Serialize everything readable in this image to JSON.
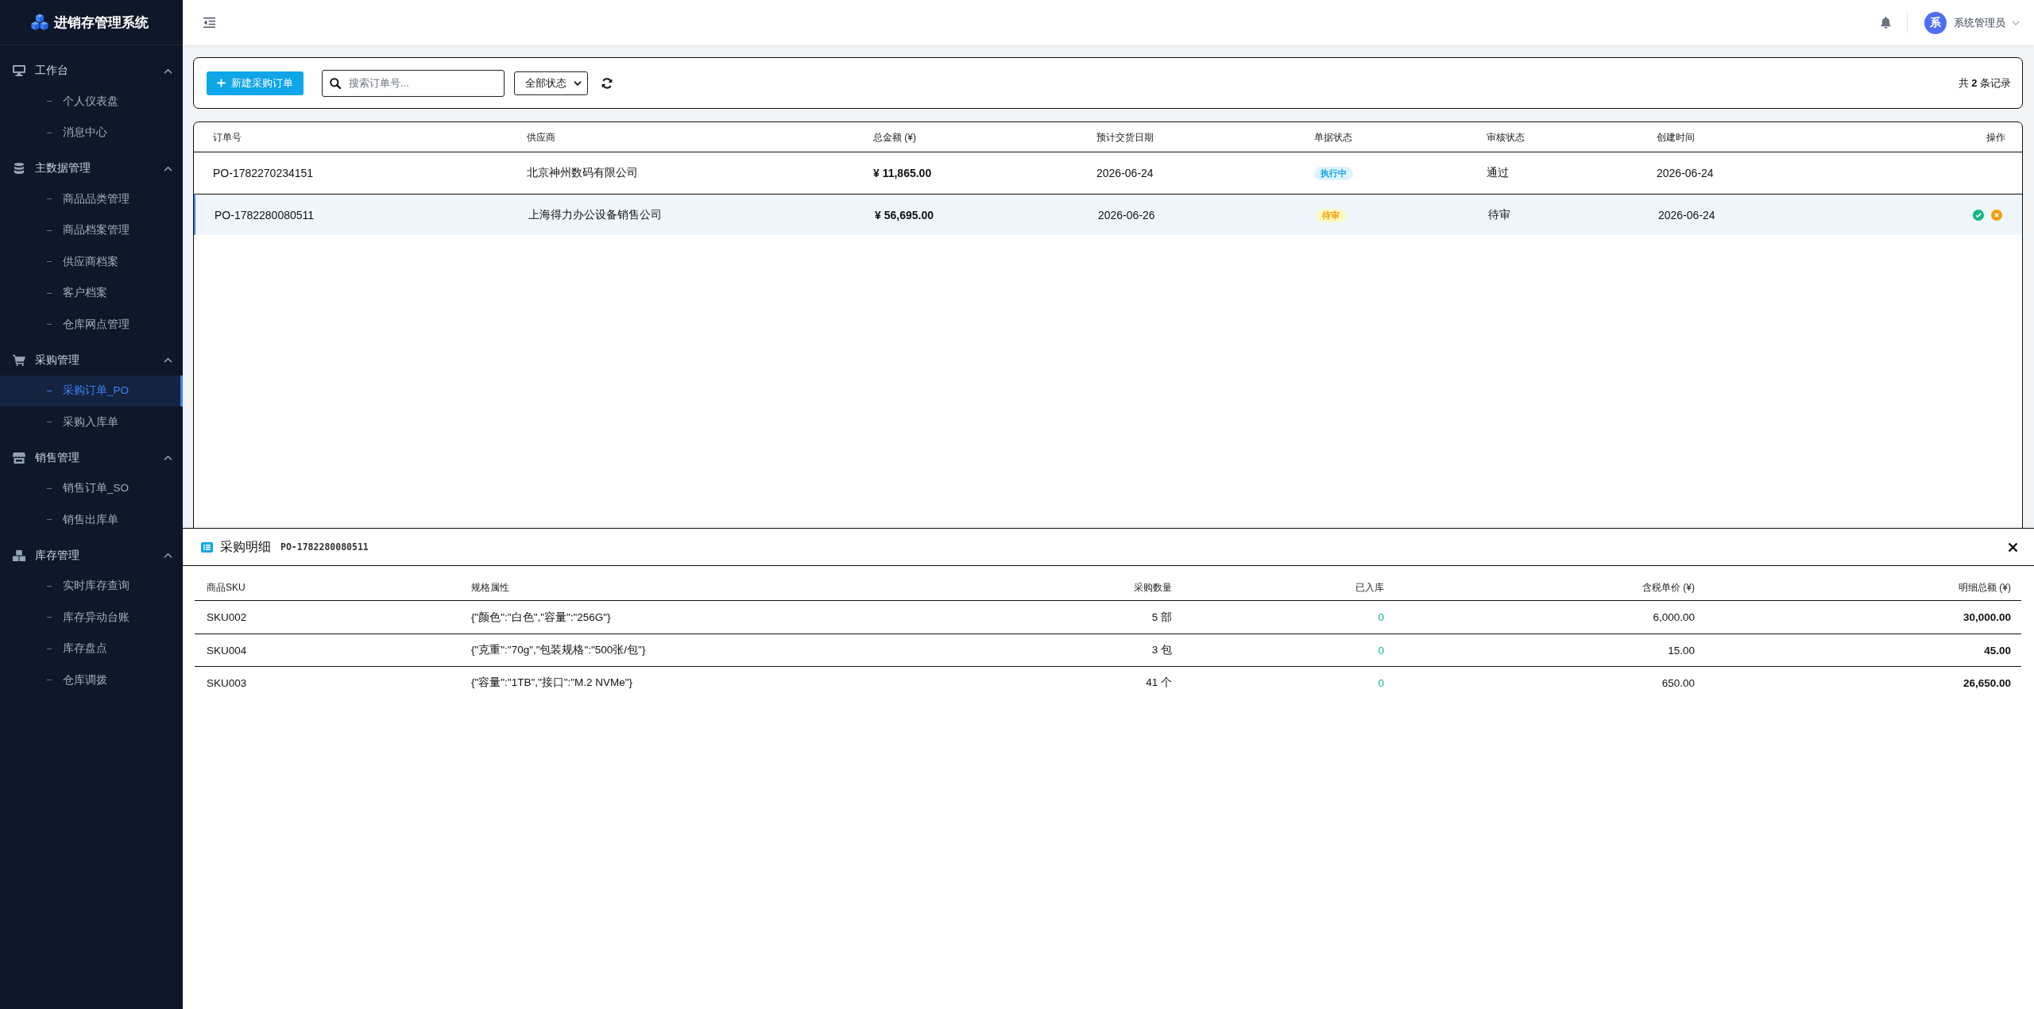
{
  "sidebar": {
    "logo": "进销存管理系统",
    "groups": [
      {
        "label": "工作台",
        "expanded": true,
        "children": [
          {
            "label": "个人仪表盘",
            "selected": false
          },
          {
            "label": "消息中心",
            "selected": false
          }
        ]
      },
      {
        "label": "主数据管理",
        "expanded": true,
        "children": [
          {
            "label": "商品品类管理",
            "selected": false
          },
          {
            "label": "商品档案管理",
            "selected": false
          },
          {
            "label": "供应商档案",
            "selected": false
          },
          {
            "label": "客户档案",
            "selected": false
          },
          {
            "label": "仓库网点管理",
            "selected": false
          }
        ]
      },
      {
        "label": "采购管理",
        "expanded": true,
        "children": [
          {
            "label": "采购订单_PO",
            "selected": true
          },
          {
            "label": "采购入库单",
            "selected": false
          }
        ]
      },
      {
        "label": "销售管理",
        "expanded": true,
        "children": [
          {
            "label": "销售订单_SO",
            "selected": false
          },
          {
            "label": "销售出库单",
            "selected": false
          }
        ]
      },
      {
        "label": "库存管理",
        "expanded": true,
        "children": [
          {
            "label": "实时库存查询",
            "selected": false
          },
          {
            "label": "库存异动台账",
            "selected": false
          },
          {
            "label": "库存盘点",
            "selected": false
          },
          {
            "label": "仓库调拨",
            "selected": false
          }
        ]
      }
    ]
  },
  "header": {
    "avatar_initial": "系",
    "user_name": "系统管理员"
  },
  "toolbar": {
    "new_button": "新建采购订单",
    "search": {
      "placeholder": "搜索订单号..."
    },
    "status_filter": "全部状态",
    "record_count": "共 **2** 条记录"
  },
  "orders_table": {
    "columns": [
      "订单号",
      "供应商",
      "总金额 (¥)",
      "预计交货日期",
      "单据状态",
      "审核状态",
      "创建时间",
      "操作"
    ],
    "rows": [
      {
        "order_no": "PO-1782270234151",
        "supplier": "北京神州数码有限公司",
        "total": "¥ 11,865.00",
        "delivery_date": "2026-06-24",
        "doc_status": {
          "text": "执行中",
          "kind": "executing"
        },
        "audit_status": "通过",
        "created": "2026-06-24",
        "selected": false
      },
      {
        "order_no": "PO-1782280080511",
        "supplier": "上海得力办公设备销售公司",
        "total": "¥ 56,695.00",
        "delivery_date": "2026-06-26",
        "doc_status": {
          "text": "待审",
          "kind": "pending"
        },
        "audit_status": "待审",
        "created": "2026-06-24",
        "selected": true,
        "actions": [
          {
            "kind": "approve"
          },
          {
            "kind": "reject"
          }
        ]
      }
    ]
  },
  "detail_panel": {
    "title": "采购明细",
    "order_no": "PO-1782280080511",
    "columns": [
      "商品SKU",
      "规格属性",
      "采购数量",
      "已入库",
      "含税单价 (¥)",
      "明细总额 (¥)"
    ],
    "rows": [
      {
        "sku": "SKU002",
        "spec": "{\"颜色\":\"白色\",\"容量\":\"256G\"}",
        "quantity": "5 部",
        "received": "0",
        "unit_price": "6,000.00",
        "line_total": "30,000.00"
      },
      {
        "sku": "SKU004",
        "spec": "{\"克重\":\"70g\",\"包装规格\":\"500张/包\"}",
        "quantity": "3 包",
        "received": "0",
        "unit_price": "15.00",
        "line_total": "45.00"
      },
      {
        "sku": "SKU003",
        "spec": "{\"容量\":\"1TB\",\"接口\":\"M.2 NVMe\"}",
        "quantity": "41 个",
        "received": "0",
        "unit_price": "650.00",
        "line_total": "26,650.00"
      }
    ]
  }
}
